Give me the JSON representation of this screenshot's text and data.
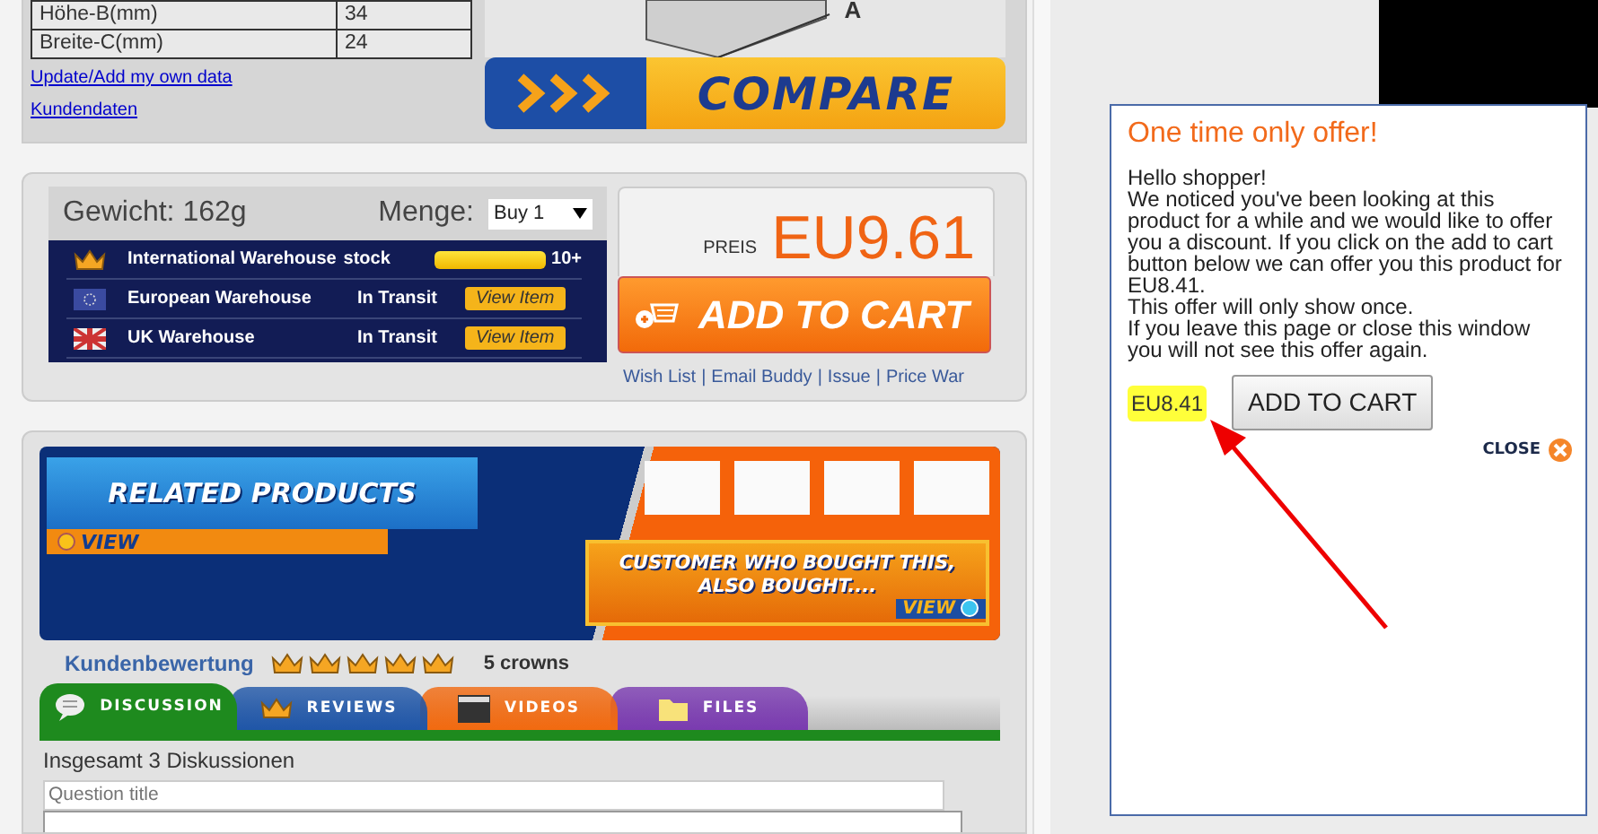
{
  "specs": [
    {
      "name": "Höhe-B(mm)",
      "value": "34"
    },
    {
      "name": "Breite-C(mm)",
      "value": "24"
    }
  ],
  "spec_links": [
    "Update/Add my own data",
    "Kundendaten"
  ],
  "dimension_label": "A",
  "compare": "COMPARE",
  "weight": "Gewicht: 162g",
  "quantity": {
    "label": "Menge:",
    "value": "Buy 1"
  },
  "warehouses": [
    {
      "name": "International Warehouse",
      "kind": "stock",
      "status": "stock",
      "level": 1,
      "count": "10+"
    },
    {
      "name": "European Warehouse",
      "kind": "transit",
      "status": "In Transit",
      "button": "View Item"
    },
    {
      "name": "UK Warehouse",
      "kind": "transit",
      "status": "In Transit",
      "button": "View Item"
    }
  ],
  "price": {
    "label": "PREIS",
    "value": "EU9.61"
  },
  "add_to_cart": "ADD TO CART",
  "links": [
    "Wish List",
    "Email Buddy",
    "Issue",
    "Price War"
  ],
  "link_separator": "|",
  "related": {
    "title": "RELATED PRODUCTS",
    "view": "VIEW"
  },
  "also_bought": {
    "title": "CUSTOMER WHO BOUGHT THIS, ALSO BOUGHT....",
    "view": "VIEW"
  },
  "rating": {
    "label": "Kundenbewertung",
    "stars": 5,
    "text": "5 crowns"
  },
  "tabs": [
    {
      "label": "DISCUSSION",
      "kind": "discussion",
      "color": "#1e8a1e",
      "selected": true
    },
    {
      "label": "REVIEWS",
      "kind": "reviews",
      "color": "#1f56a8",
      "selected": false
    },
    {
      "label": "VIDEOS",
      "kind": "videos",
      "color": "#f26a10",
      "selected": false
    },
    {
      "label": "FILES",
      "kind": "files",
      "color": "#7a3bb0",
      "selected": false
    }
  ],
  "discussion": {
    "count": "Insgesamt 3 Diskussionen",
    "title_placeholder": "Question title"
  },
  "popup": {
    "title": "One time only offer!",
    "lines": [
      "Hello shopper!",
      "We noticed you've been looking at this product for a while and we would like to offer you a discount. If you click on the add to cart button below we can offer you this product for EU8.41.",
      "This offer will only show once.",
      "If you leave this page or close this window you will not see this offer again."
    ],
    "offer_price": "EU8.41",
    "button": "ADD TO CART",
    "close": "CLOSE"
  }
}
